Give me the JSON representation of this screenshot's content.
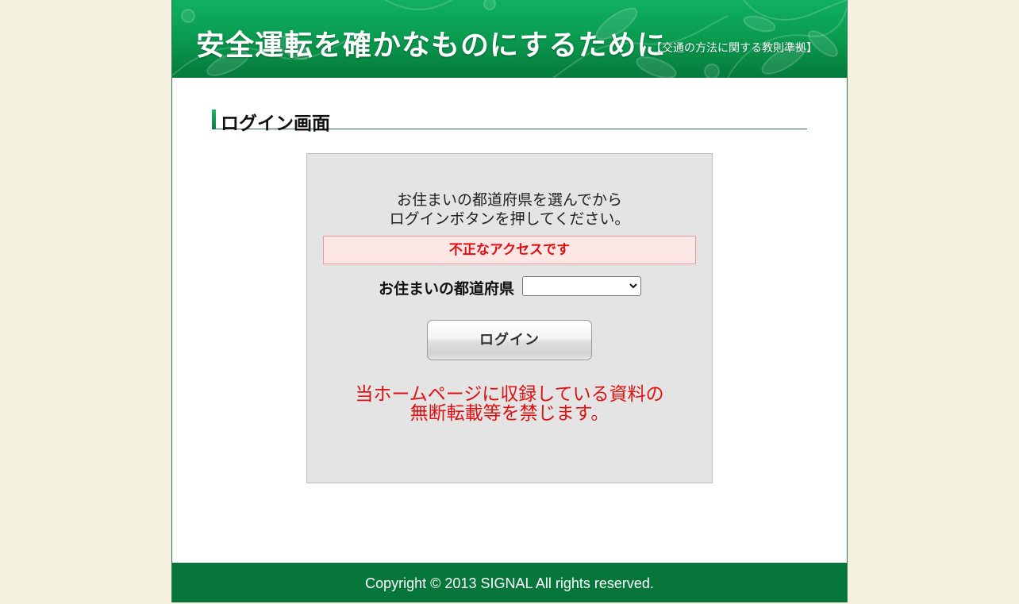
{
  "header": {
    "title": "安全運転を確かなものにするために",
    "subtitle": "【交通の方法に関する教則準拠】"
  },
  "section": {
    "heading": "ログイン画面"
  },
  "login": {
    "instruction_line1": "お住まいの都道府県を選んでから",
    "instruction_line2": "ログインボタンを押してください。",
    "error_message": "不正なアクセスです",
    "prefecture_label": "お住まいの都道府県",
    "prefecture_selected": "",
    "button_label": "ログイン",
    "notice_line1": "当ホームページに収録している資料の",
    "notice_line2": "無断転載等を禁じます。"
  },
  "footer": {
    "copyright": "Copyright © 2013 SIGNAL All rights reserved."
  },
  "colors": {
    "background": "#f5f1e1",
    "brand_green": "#06763b",
    "header_green": "#0a9d52",
    "error_red": "#dd1111",
    "error_bg": "#fde6e6",
    "panel_gray": "#e4e4e4"
  },
  "icons": {
    "select_arrow": "chevron-down-icon",
    "header_decoration": "leaf-pattern"
  }
}
